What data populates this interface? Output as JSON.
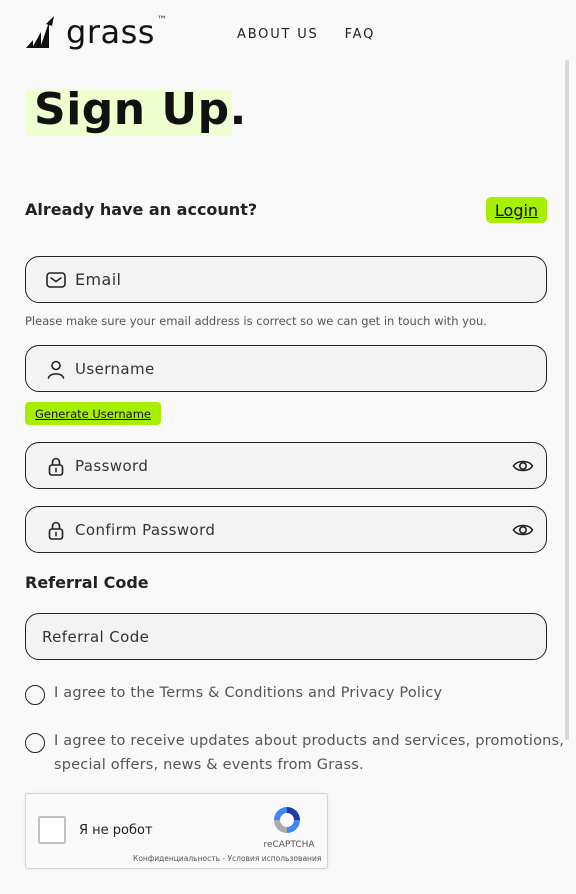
{
  "header": {
    "brand": "grass",
    "brand_tm": "™",
    "nav": {
      "about": "ABOUT US",
      "faq": "FAQ"
    }
  },
  "page_title": "Sign Up.",
  "account": {
    "prompt": "Already have an account?",
    "login_label": "Login"
  },
  "form": {
    "email_placeholder": "Email",
    "email_hint": "Please make sure your email address is correct so we can get in touch with you.",
    "username_placeholder": "Username",
    "generate_username_label": "Generate Username",
    "password_placeholder": "Password",
    "confirm_password_placeholder": "Confirm Password",
    "referral_label": "Referral Code",
    "referral_placeholder": "Referral Code",
    "terms_label": "I agree to the Terms & Conditions and Privacy Policy",
    "updates_line1": "I agree to receive updates about products and services, promotions,",
    "updates_line2": "special offers, news & events from Grass."
  },
  "recaptcha": {
    "label": "Я не робот",
    "brand": "reCAPTCHA",
    "links": "Конфиденциальность - Условия использования"
  },
  "colors": {
    "accent": "#a6ef00",
    "title_highlight": "#efffd0",
    "field_bg": "#f3f3f3"
  },
  "icons": [
    "grass-logo-icon",
    "mail-icon",
    "user-icon",
    "lock-icon",
    "eye-icon",
    "recaptcha-icon"
  ]
}
